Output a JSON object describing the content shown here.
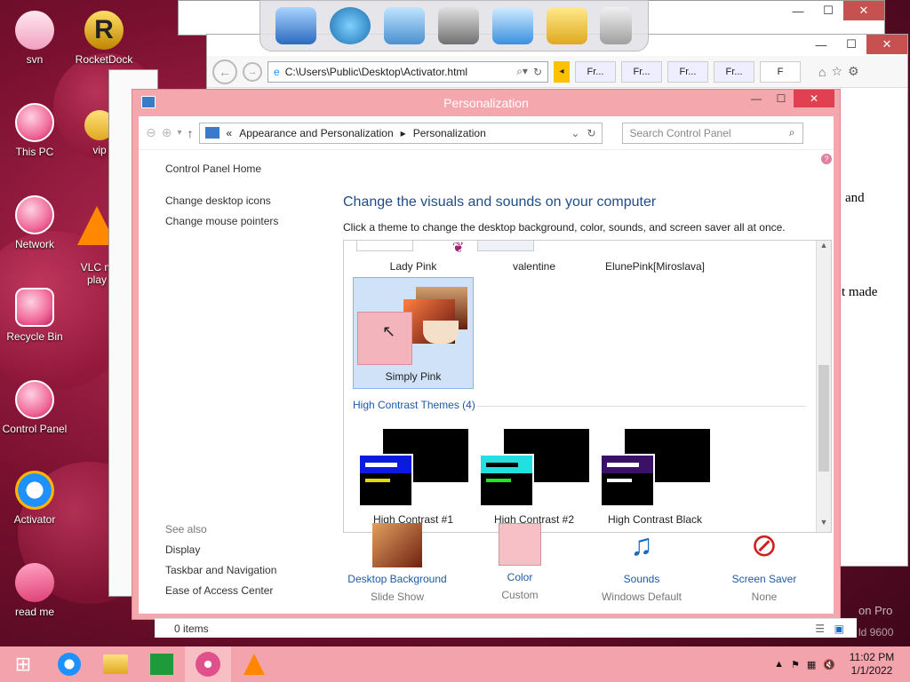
{
  "desktop": {
    "icons": [
      {
        "label": "svn"
      },
      {
        "label": "RocketDock"
      },
      {
        "label": "This PC"
      },
      {
        "label": "vip"
      },
      {
        "label": "Network"
      },
      {
        "label": "VLC m\nplay"
      },
      {
        "label": "Recycle Bin"
      },
      {
        "label": "Control Panel"
      },
      {
        "label": "Activator"
      },
      {
        "label": "read me"
      }
    ]
  },
  "ie": {
    "address": "C:\\Users\\Public\\Desktop\\Activator.html",
    "tabs": [
      "Fr...",
      "Fr...",
      "Fr...",
      "Fr...",
      "F"
    ],
    "page_text_1": "and",
    "page_text_2": "t made",
    "page_text_3": "on Pro",
    "page_text_4": "ld 9600"
  },
  "window": {
    "title": "Personalization",
    "minimize": "—",
    "maximize": "☐",
    "close": "✕",
    "breadcrumb": [
      "«",
      "Appearance and Personalization",
      "▸",
      "Personalization"
    ],
    "search_placeholder": "Search Control Panel"
  },
  "left_nav": {
    "home": "Control Panel Home",
    "links": [
      "Change desktop icons",
      "Change mouse pointers"
    ],
    "see_also_label": "See also",
    "see_also": [
      "Display",
      "Taskbar and Navigation",
      "Ease of Access Center"
    ]
  },
  "main": {
    "heading": "Change the visuals and sounds on your computer",
    "subtitle": "Click a theme to change the desktop background, color, sounds, and screen saver all at once.",
    "top_themes": [
      "Lady Pink",
      "valentine",
      "ElunePink[Miroslava]"
    ],
    "selected_theme": "Simply Pink",
    "group_header": "High Contrast Themes (4)",
    "high_contrast": [
      {
        "name": "High Contrast #1",
        "accent": "#0a1ae0",
        "bar": "#e6d800"
      },
      {
        "name": "High Contrast #2",
        "accent": "#22e0e0",
        "bar": "#1ee81e"
      },
      {
        "name": "High Contrast Black",
        "accent": "#3a1068",
        "bar": "#ffffff"
      }
    ]
  },
  "bottom": [
    {
      "label": "Desktop Background",
      "value": "Slide Show"
    },
    {
      "label": "Color",
      "value": "Custom"
    },
    {
      "label": "Sounds",
      "value": "Windows Default"
    },
    {
      "label": "Screen Saver",
      "value": "None"
    }
  ],
  "status": {
    "items": "0 items"
  },
  "taskbar": {
    "time": "11:02 PM",
    "date": "1/1/2022"
  },
  "colors": {
    "accent_pink": "#f4a8ae",
    "link_blue": "#1e5aa8"
  }
}
